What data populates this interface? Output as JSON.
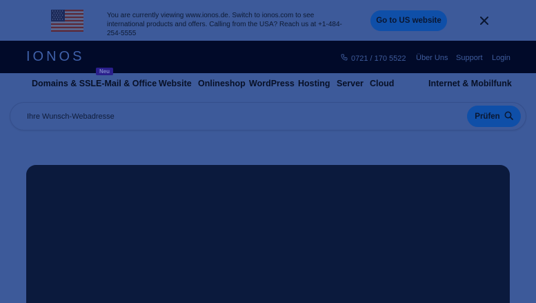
{
  "banner": {
    "message": "You are currently viewing www.ionos.de. Switch to ionos.com to see international products and offers. Calling from the USA? Reach us at +1-484-254-5555",
    "cta_label": "Go to US website",
    "close_icon": "close-icon",
    "flag_icon": "us-flag-icon"
  },
  "header": {
    "logo": "IONOS",
    "phone": "0721 / 170 5522",
    "phone_icon": "phone-icon",
    "links": [
      "Über Uns",
      "Support",
      "Login"
    ]
  },
  "nav": {
    "items": [
      "Domains & SSL",
      "E-Mail & Office",
      "Website",
      "Onlineshop",
      "WordPress",
      "Hosting",
      "Server",
      "Cloud",
      "Internet & Mobilfunk"
    ],
    "new_badge": "Neu"
  },
  "search": {
    "placeholder": "Ihre Wunsch-Webadresse",
    "button_label": "Prüfen",
    "button_icon": "search-icon"
  },
  "colors": {
    "overlay": "#3d5a9a",
    "header_bg": "#010a29",
    "primary_button": "#0f4fa8",
    "hero_bg": "#0b1a3d"
  }
}
